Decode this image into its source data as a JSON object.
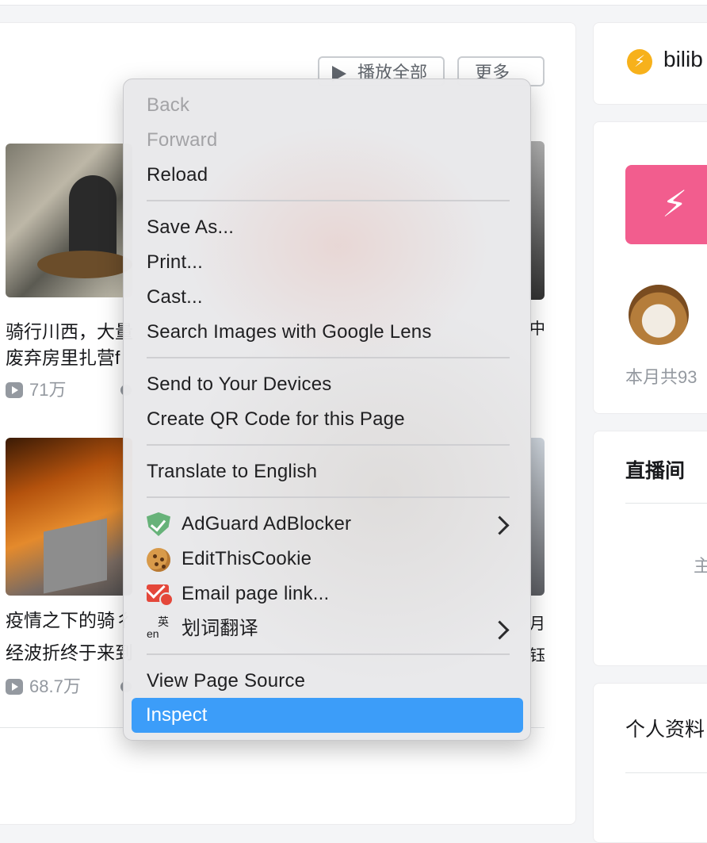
{
  "page": {
    "header_buttons": {
      "play_all": "播放全部",
      "more": "更多"
    },
    "videos": [
      {
        "title_line1": "骑行川西，大量",
        "title_line2": "废弃房里扎营f",
        "plays": "71万"
      },
      {
        "title_line1": "疫情之下的骑彳",
        "title_line2": "经波折终于来到",
        "plays": "68.7万"
      }
    ],
    "right_fragments": {
      "r1": "中",
      "r2": "月",
      "r3": "钰"
    }
  },
  "sidebar": {
    "brand": "bilib",
    "month_text": "本月共93",
    "live_title": "直播间",
    "live_fragment": "主",
    "profile_title": "个人资料"
  },
  "context_menu": {
    "back": "Back",
    "forward": "Forward",
    "reload": "Reload",
    "save_as": "Save As...",
    "print": "Print...",
    "cast": "Cast...",
    "search_images": "Search Images with Google Lens",
    "send_devices": "Send to Your Devices",
    "qr_code": "Create QR Code for this Page",
    "translate": "Translate to English",
    "adguard": "AdGuard AdBlocker",
    "editthiscookie": "EditThisCookie",
    "email_link": "Email page link...",
    "word_translate": "划词翻译",
    "word_translate_icon_top": "英",
    "word_translate_icon_bottom": "en",
    "view_source": "View Page Source",
    "inspect": "Inspect"
  },
  "colors": {
    "highlight": "#3c9df9",
    "pink_tile": "#f25d8e",
    "bolt": "#f7b11b"
  }
}
